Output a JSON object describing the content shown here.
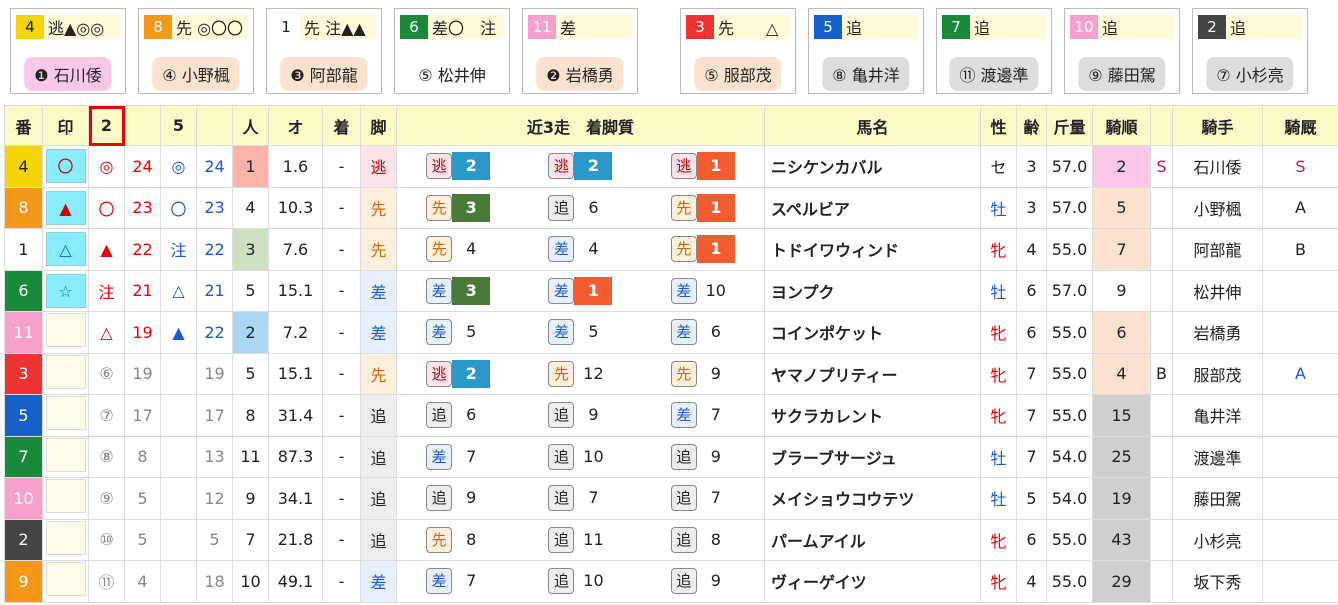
{
  "colors": {
    "waku": [
      "#fff",
      "#fff",
      "#444",
      "#e33",
      "#1560c9",
      "#f4d40a",
      "#1a8a3a",
      "#f39818",
      "#f7a0cc"
    ],
    "waku_text": [
      "#222",
      "#222",
      "#fff",
      "#fff",
      "#fff",
      "#222",
      "#fff",
      "#fff",
      "#fff"
    ],
    "kb_bg": {
      "逃": "#fde3ea",
      "先": "#fff0dd",
      "差": "#e8f0ff",
      "追": "#eee"
    },
    "kb_fg": {
      "逃": "#c00",
      "先": "#d06a00",
      "差": "#1a5bd6",
      "追": "#222"
    },
    "num_bg": {
      "1": "#f25c2f",
      "2": "#2a98c8",
      "3": "#4a7a3a"
    },
    "rank_bg": {
      "1": "#fbb3aa",
      "2": "#a9d6f2",
      "3": "#cde0bf"
    },
    "jorder_bg": {
      "2": "#fbc8ea",
      "4": "#fde3cf",
      "5": "#fde3cf",
      "6": "#fde3cf",
      "7": "#fde3cf",
      "9": "#fff",
      "15": "#cfcfcf",
      "19": "#cfcfcf",
      "25": "#cfcfcf",
      "29": "#cfcfcf",
      "43": "#cfcfcf"
    }
  },
  "cards": [
    {
      "num": "4",
      "waku": 5,
      "marks": "逃▲◎◎",
      "jockey": "❶ 石川倭",
      "jbg": "#fbc8ea"
    },
    {
      "num": "8",
      "waku": 7,
      "marks": "先 ◎〇〇",
      "jockey": "④ 小野楓",
      "jbg": "#fde3cf"
    },
    {
      "num": "1",
      "waku": 1,
      "marks": "先 注▲▲",
      "jockey": "❸ 阿部龍",
      "jbg": "#fde3cf"
    },
    {
      "num": "6",
      "waku": 6,
      "marks": "差〇　注",
      "jockey": "⑤ 松井伸",
      "jbg": "#fff"
    },
    {
      "num": "11",
      "waku": 8,
      "marks": "差",
      "jockey": "❷ 岩橋勇",
      "jbg": "#fde3cf"
    },
    {
      "num": "3",
      "waku": 3,
      "marks": "先　　△",
      "jockey": "⑤ 服部茂",
      "jbg": "#fde3cf"
    },
    {
      "num": "5",
      "waku": 4,
      "marks": "追",
      "jockey": "⑧ 亀井洋",
      "jbg": "#ddd"
    },
    {
      "num": "7",
      "waku": 6,
      "marks": "追",
      "jockey": "⑪ 渡邊準",
      "jbg": "#ddd"
    },
    {
      "num": "10",
      "waku": 8,
      "marks": "追",
      "jockey": "⑨ 藤田駕",
      "jbg": "#ddd"
    },
    {
      "num": "2",
      "waku": 2,
      "marks": "追",
      "jockey": "⑦ 小杉亮",
      "jbg": "#ddd"
    }
  ],
  "headers": {
    "ban": "番",
    "shirushi": "印",
    "c2": "2",
    "c5": "5",
    "ninki": "人",
    "odds": "オ",
    "chaku": "着",
    "ashi": "脚",
    "kinkyo": "近3走　着脚質",
    "name": "馬名",
    "sex": "性",
    "age": "齢",
    "kinryo": "斤量",
    "kijun": "騎順",
    "kishu": "騎手",
    "kikyu": "騎厩"
  },
  "rows": [
    {
      "ban": "4",
      "waku": 5,
      "mark": "〇",
      "m2": "◎",
      "v2": "24",
      "m5": "◎",
      "v5": "24",
      "ninki": "1",
      "odds": "1.6",
      "chaku": "-",
      "ashi": "逃",
      "k": [
        [
          "逃",
          "2"
        ],
        [
          "逃",
          "2"
        ],
        [
          "逃",
          "1"
        ]
      ],
      "name": "ニシケンカバル",
      "sex": "セ",
      "age": "3",
      "kinryo": "57.0",
      "jorder": "2",
      "jmark": "S",
      "jockey": "石川倭",
      "kikyu": "S"
    },
    {
      "ban": "8",
      "waku": 7,
      "mark": "▲",
      "m2": "〇",
      "v2": "23",
      "m5": "〇",
      "v5": "23",
      "ninki": "4",
      "odds": "10.3",
      "chaku": "-",
      "ashi": "先",
      "k": [
        [
          "先",
          "3"
        ],
        [
          "追",
          "6"
        ],
        [
          "先",
          "1"
        ]
      ],
      "name": "スペルビア",
      "sex": "牡",
      "age": "3",
      "kinryo": "57.0",
      "jorder": "5",
      "jmark": "",
      "jockey": "小野楓",
      "kikyu": "A"
    },
    {
      "ban": "1",
      "waku": 1,
      "mark": "△",
      "m2": "▲",
      "v2": "22",
      "m5": "注",
      "v5": "22",
      "ninki": "3",
      "odds": "7.6",
      "chaku": "-",
      "ashi": "先",
      "k": [
        [
          "先",
          "4"
        ],
        [
          "差",
          "4"
        ],
        [
          "先",
          "1"
        ]
      ],
      "name": "トドイワウィンド",
      "sex": "牝",
      "age": "4",
      "kinryo": "55.0",
      "jorder": "7",
      "jmark": "",
      "jockey": "阿部龍",
      "kikyu": "B"
    },
    {
      "ban": "6",
      "waku": 6,
      "mark": "☆",
      "m2": "注",
      "v2": "21",
      "m5": "△",
      "v5": "21",
      "ninki": "5",
      "odds": "15.1",
      "chaku": "-",
      "ashi": "差",
      "k": [
        [
          "差",
          "3"
        ],
        [
          "差",
          "1"
        ],
        [
          "差",
          "10"
        ]
      ],
      "name": "ヨンプク",
      "sex": "牡",
      "age": "6",
      "kinryo": "57.0",
      "jorder": "9",
      "jmark": "",
      "jockey": "松井伸",
      "kikyu": ""
    },
    {
      "ban": "11",
      "waku": 8,
      "mark": "",
      "m2": "△",
      "v2": "19",
      "m5": "▲",
      "v5": "22",
      "ninki": "2",
      "odds": "7.2",
      "chaku": "-",
      "ashi": "差",
      "k": [
        [
          "差",
          "5"
        ],
        [
          "差",
          "5"
        ],
        [
          "差",
          "6"
        ]
      ],
      "name": "コインポケット",
      "sex": "牝",
      "age": "6",
      "kinryo": "55.0",
      "jorder": "6",
      "jmark": "",
      "jockey": "岩橋勇",
      "kikyu": ""
    },
    {
      "ban": "3",
      "waku": 3,
      "mark": "",
      "m2": "⑥",
      "v2": "19",
      "m5": "",
      "v5": "19",
      "ninki": "5",
      "odds": "15.1",
      "chaku": "-",
      "ashi": "先",
      "k": [
        [
          "逃",
          "2"
        ],
        [
          "先",
          "12"
        ],
        [
          "先",
          "9"
        ]
      ],
      "name": "ヤマノプリティー",
      "sex": "牝",
      "age": "7",
      "kinryo": "55.0",
      "jorder": "4",
      "jmark": "B",
      "jockey": "服部茂",
      "kikyu": "A"
    },
    {
      "ban": "5",
      "waku": 4,
      "mark": "",
      "m2": "⑦",
      "v2": "17",
      "m5": "",
      "v5": "17",
      "ninki": "8",
      "odds": "31.4",
      "chaku": "-",
      "ashi": "追",
      "k": [
        [
          "追",
          "6"
        ],
        [
          "追",
          "9"
        ],
        [
          "差",
          "7"
        ]
      ],
      "name": "サクラカレント",
      "sex": "牝",
      "age": "7",
      "kinryo": "55.0",
      "jorder": "15",
      "jmark": "",
      "jockey": "亀井洋",
      "kikyu": ""
    },
    {
      "ban": "7",
      "waku": 6,
      "mark": "",
      "m2": "⑧",
      "v2": "8",
      "m5": "",
      "v5": "13",
      "ninki": "11",
      "odds": "87.3",
      "chaku": "-",
      "ashi": "追",
      "k": [
        [
          "差",
          "7"
        ],
        [
          "追",
          "10"
        ],
        [
          "追",
          "9"
        ]
      ],
      "name": "ブラーブサージュ",
      "sex": "牡",
      "age": "7",
      "kinryo": "54.0",
      "jorder": "25",
      "jmark": "",
      "jockey": "渡邊準",
      "kikyu": ""
    },
    {
      "ban": "10",
      "waku": 8,
      "mark": "",
      "m2": "⑨",
      "v2": "5",
      "m5": "",
      "v5": "12",
      "ninki": "9",
      "odds": "34.1",
      "chaku": "-",
      "ashi": "追",
      "k": [
        [
          "追",
          "9"
        ],
        [
          "追",
          "7"
        ],
        [
          "追",
          "7"
        ]
      ],
      "name": "メイショウコウテツ",
      "sex": "牡",
      "age": "5",
      "kinryo": "54.0",
      "jorder": "19",
      "jmark": "",
      "jockey": "藤田駕",
      "kikyu": ""
    },
    {
      "ban": "2",
      "waku": 2,
      "mark": "",
      "m2": "⑩",
      "v2": "5",
      "m5": "",
      "v5": "5",
      "ninki": "7",
      "odds": "21.8",
      "chaku": "-",
      "ashi": "追",
      "k": [
        [
          "先",
          "8"
        ],
        [
          "追",
          "11"
        ],
        [
          "追",
          "8"
        ]
      ],
      "name": "パームアイル",
      "sex": "牝",
      "age": "6",
      "kinryo": "55.0",
      "jorder": "43",
      "jmark": "",
      "jockey": "小杉亮",
      "kikyu": ""
    },
    {
      "ban": "9",
      "waku": 7,
      "mark": "",
      "m2": "⑪",
      "v2": "4",
      "m5": "",
      "v5": "18",
      "ninki": "10",
      "odds": "49.1",
      "chaku": "-",
      "ashi": "差",
      "k": [
        [
          "差",
          "7"
        ],
        [
          "追",
          "10"
        ],
        [
          "追",
          "9"
        ]
      ],
      "name": "ヴィーゲイツ",
      "sex": "牝",
      "age": "4",
      "kinryo": "55.0",
      "jorder": "29",
      "jmark": "",
      "jockey": "坂下秀",
      "kikyu": ""
    }
  ]
}
